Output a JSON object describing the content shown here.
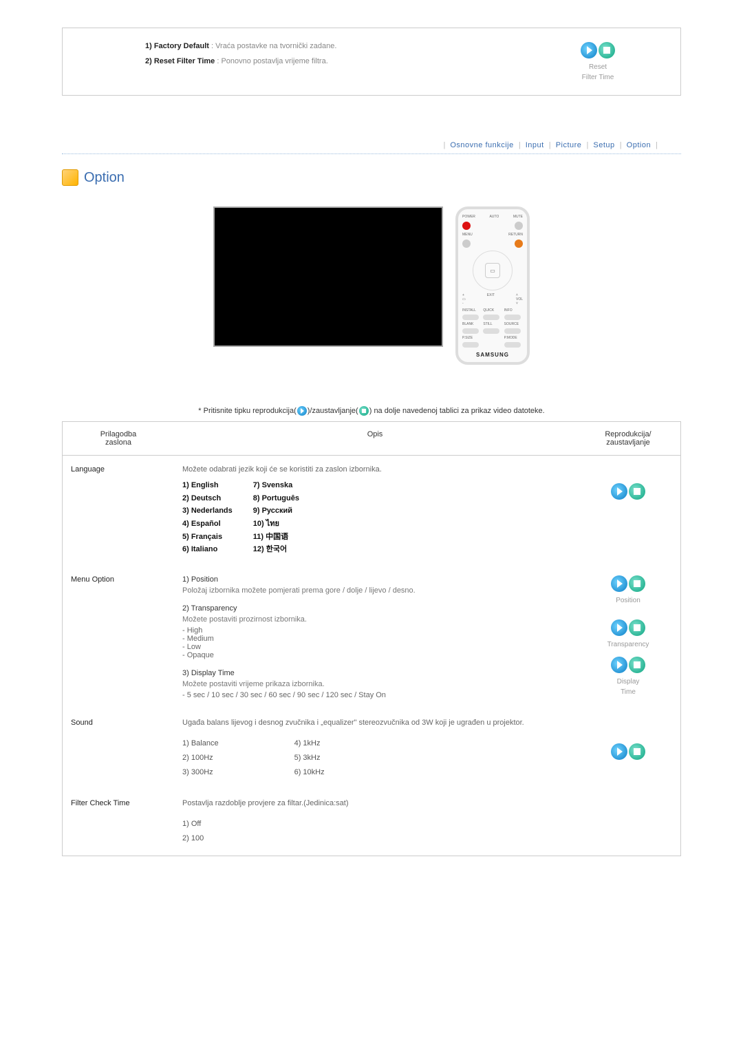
{
  "panel": {
    "item1_label": "1) Factory Default",
    "item1_desc": ": Vraća postavke na tvornički zadane.",
    "item2_label": "2) Reset Filter Time",
    "item2_desc": ": Ponovno postavlja vrijeme filtra.",
    "side_line1": "Reset",
    "side_line2": "Filter Time"
  },
  "nav": {
    "osnovne": "Osnovne funkcije",
    "input": "Input",
    "picture": "Picture",
    "setup": "Setup",
    "option": "Option"
  },
  "section_title": "Option",
  "remote": {
    "power": "POWER",
    "auto": "AUTO",
    "mute": "MUTE",
    "menu": "MENU",
    "return": "RETURN",
    "exit": "EXIT",
    "vol": "VOL",
    "install": "INSTALL",
    "quick": "QUICK",
    "info": "INFO",
    "blank": "BLANK",
    "still": "STILL",
    "source": "SOURCE",
    "psize": "P.SIZE",
    "pmode": "P.MODE",
    "brand": "SAMSUNG"
  },
  "note_pre": "* Pritisnite tipku reprodukcija(",
  "note_mid": ")/zaustavljanje(",
  "note_post": ") na dolje navedenoj tablici za prikaz video datoteke.",
  "headers": {
    "col1a": "Prilagodba",
    "col1b": "zaslona",
    "col2": "Opis",
    "col3a": "Reprodukcija/",
    "col3b": "zaustavljanje"
  },
  "rows": {
    "language": {
      "label": "Language",
      "desc": "Možete odabrati jezik koji će se koristiti za zaslon izbornika.",
      "left": [
        "1) English",
        "2) Deutsch",
        "3) Nederlands",
        "4) Español",
        "5) Français",
        "6) Italiano"
      ],
      "right": [
        "7) Svenska",
        "8) Português",
        "9) Русский",
        "10) ไทย",
        "11) 中国语",
        "12) 한국어"
      ]
    },
    "menu_option": {
      "label": "Menu Option",
      "pos_title": "1) Position",
      "pos_desc": "Položaj izbornika možete pomjerati prema gore / dolje / lijevo / desno.",
      "trans_title": "2) Transparency",
      "trans_desc": "Možete postaviti prozirnost izbornika.",
      "trans_opts": [
        "- High",
        "- Medium",
        "- Low",
        "- Opaque"
      ],
      "disp_title": "3) Display Time",
      "disp_desc": "Možete postaviti vrijeme prikaza izbornika.",
      "disp_opts": "- 5 sec / 10 sec / 30 sec / 60 sec / 90 sec / 120 sec / Stay On",
      "cap_position": "Position",
      "cap_trans": "Transparency",
      "cap_disp1": "Display",
      "cap_disp2": "Time"
    },
    "sound": {
      "label": "Sound",
      "desc": "Ugađa balans lijevog i desnog zvučnika i „equalizer\" stereozvučnika od 3W koji je ugrađen u projektor.",
      "left": [
        "1) Balance",
        "2) 100Hz",
        "3) 300Hz"
      ],
      "right": [
        "4) 1kHz",
        "5) 3kHz",
        "6) 10kHz"
      ]
    },
    "filter": {
      "label": "Filter Check Time",
      "desc": "Postavlja razdoblje provjere za filtar.(Jedinica:sat)",
      "opts": [
        "1) Off",
        "2) 100"
      ]
    }
  }
}
